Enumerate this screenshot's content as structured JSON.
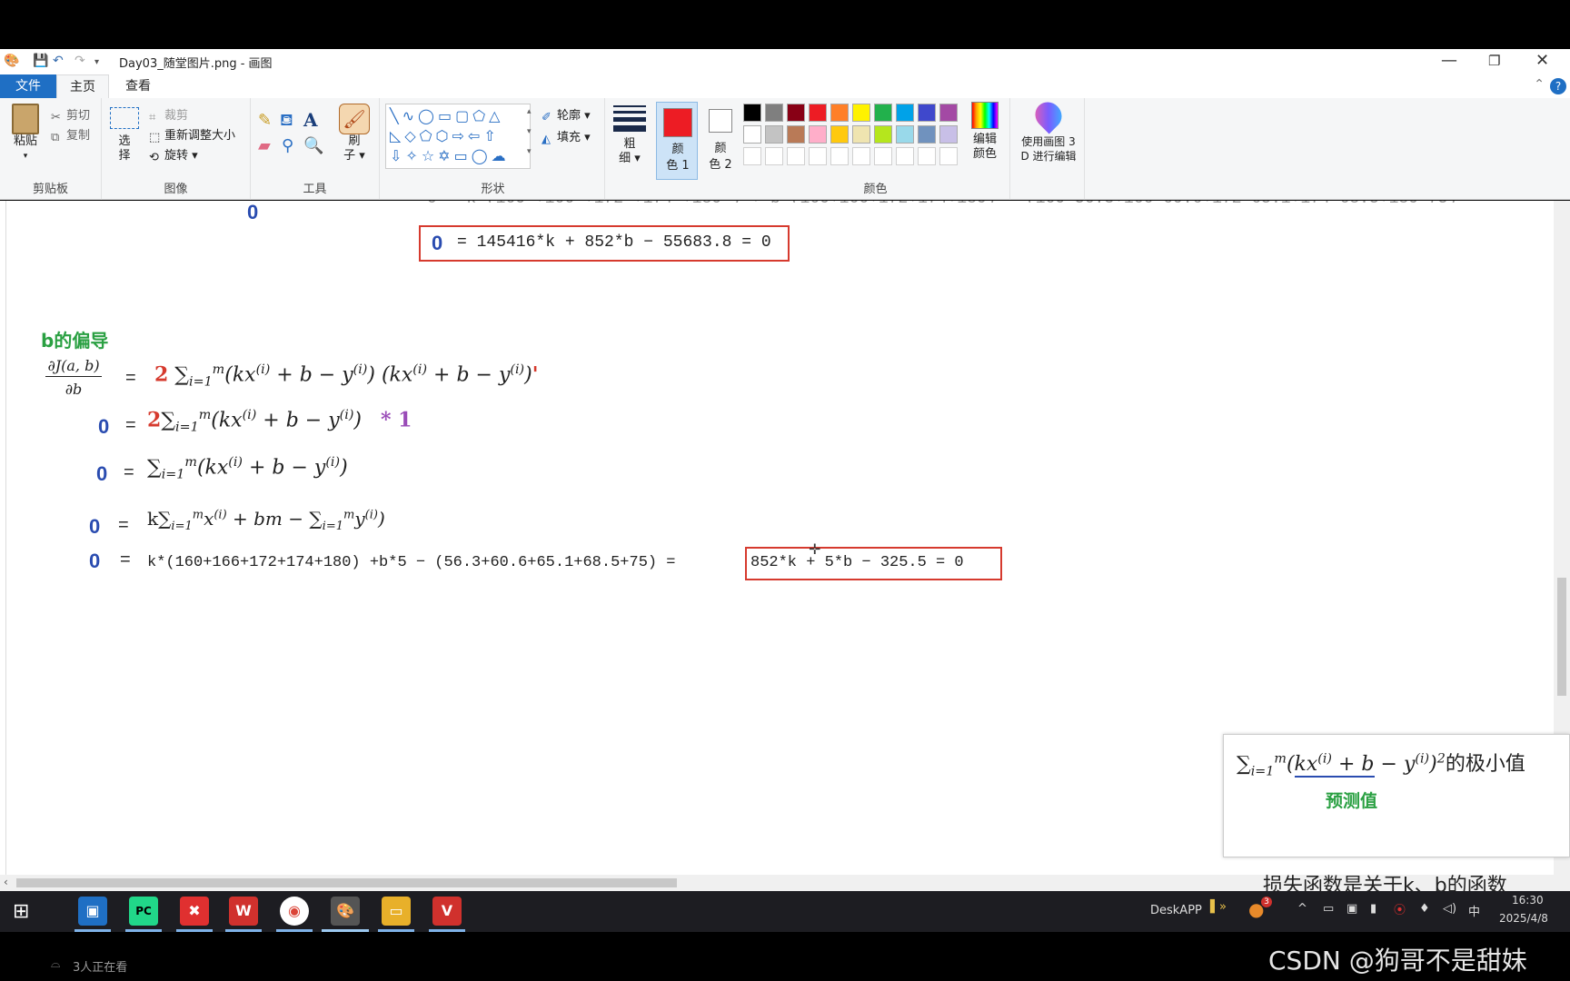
{
  "window": {
    "title": "Day03_随堂图片.png - 画图",
    "controls": [
      "—",
      "❐",
      "✕"
    ]
  },
  "tabs": {
    "file": "文件",
    "home": "主页",
    "view": "查看",
    "help": "?"
  },
  "ribbon": {
    "clipboard": {
      "paste": "粘贴",
      "cut": "剪切",
      "copy": "复制",
      "label": "剪贴板"
    },
    "image": {
      "select": "选择",
      "crop": "裁剪",
      "resize": "重新调整大小",
      "rotate": "旋转",
      "label": "图像"
    },
    "tools": {
      "label": "工具",
      "text_icon": "A"
    },
    "brush": {
      "label_top": "刷",
      "label_bottom": "子"
    },
    "shapes": {
      "label": "形状",
      "outline": "轮廓",
      "fill": "填充"
    },
    "size": {
      "top": "粗",
      "bottom": "细"
    },
    "color1": {
      "top": "颜",
      "bottom": "色 1"
    },
    "color2": {
      "top": "颜",
      "bottom": "色 2"
    },
    "colors_label": "颜色",
    "edit_colors": {
      "top": "编辑",
      "bottom": "颜色"
    },
    "paint3d": {
      "top": "使用画图 3",
      "bottom": "D 进行编辑"
    },
    "palette_colors": [
      "#000000",
      "#7f7f7f",
      "#880015",
      "#ed1c24",
      "#ff7f27",
      "#fff200",
      "#22b14c",
      "#00a2e8",
      "#3f48cc",
      "#a349a4",
      "#ffffff",
      "#c3c3c3",
      "#b97a57",
      "#ffaec9",
      "#ffc90e",
      "#efe4b0",
      "#b5e61d",
      "#99d9ea",
      "#7092be",
      "#c8bfe7"
    ],
    "color1_value": "#ed1c24",
    "color2_value": "#ffffff"
  },
  "canvas": {
    "top_zero": "0",
    "eq1_zero": "0",
    "eq1_text": "= 145416*k + 852*b − 55683.8 = 0",
    "section_title": "b的偏导",
    "partial_num": "∂J(a, b)",
    "partial_den": "∂b",
    "line1_eq": "=",
    "line1_two": "2",
    "line2_zero": "0",
    "line2_two": "2",
    "line2_times": "* 1",
    "line3_zero": "0",
    "line4_zero": "0",
    "line4_k": "k",
    "line5_zero": "0",
    "line5_text": "k*(160+166+172+174+180)  +b*5 − (56.3+60.6+65.1+68.5+75) =",
    "line5_result": "852*k +  5*b  − 325.5 = 0"
  },
  "overlay": {
    "suffix": "的极小值",
    "label": "预测值"
  },
  "taskbar": {
    "deskapp": "DeskAPP",
    "ime": "中",
    "time": "16:30",
    "date": "2025/4/8",
    "badge": "3"
  },
  "bottom": {
    "watching": "3人正在看",
    "watermark": "CSDN @狗哥不是甜妹",
    "subtitle": "损失函数是关于k、b的函数"
  }
}
